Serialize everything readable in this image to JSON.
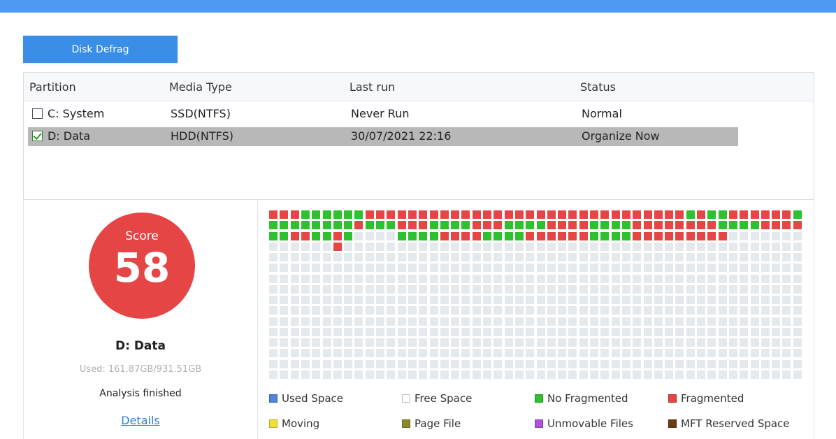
{
  "toolbar": {
    "defrag_label": "Disk Defrag"
  },
  "table": {
    "headers": {
      "partition": "Partition",
      "media_type": "Media Type",
      "last_run": "Last run",
      "status": "Status"
    },
    "rows": [
      {
        "checked": false,
        "partition": "C:  System",
        "media_type": "SSD(NTFS)",
        "last_run": "Never Run",
        "status": "Normal"
      },
      {
        "checked": true,
        "partition": "D:  Data",
        "media_type": "HDD(NTFS)",
        "last_run": "30/07/2021 22:16",
        "status": "Organize Now"
      }
    ]
  },
  "summary": {
    "score_label": "Score",
    "score_value": "58",
    "drive_name": "D:  Data",
    "used": "Used: 161.87GB/931.51GB",
    "analysis": "Analysis finished",
    "details_link": "Details"
  },
  "cluster_map": {
    "columns": 50,
    "rows": 16,
    "colors": {
      "R": "#e64545",
      "G": "#2ec02e",
      "F": "#e4e9ee"
    },
    "filled_rows": [
      "RRRGGGGGGRRRRRRRRRRRRRRRRRRRRRRRRRRRRRRGRGGRRRRRRG",
      "GGGGGGGGRGGGRRRGGGGRRRGGGGRRRRGGGGRRRRRRRRGGGGRRRR",
      "GGRRGGRGFFFFGGGGRRRRGGGGRRRRRRGGGGRRRRRRRRRFFFFFFF",
      "FFFFFFRFFFFFFFFFFFFFFFFFFFFFFFFFFFFFFFFFFFFFFFFFFF"
    ]
  },
  "legend": [
    {
      "label": "Used Space",
      "color": "#4d86d8"
    },
    {
      "label": "Free Space",
      "color": "#ffffff"
    },
    {
      "label": "No Fragmented",
      "color": "#2ec02e"
    },
    {
      "label": "Fragmented",
      "color": "#e64545"
    },
    {
      "label": "Moving",
      "color": "#f0e030"
    },
    {
      "label": "Page File",
      "color": "#8a8a2a"
    },
    {
      "label": "Unmovable Files",
      "color": "#b050e0"
    },
    {
      "label": "MFT Reserved Space",
      "color": "#6a3a10"
    }
  ]
}
